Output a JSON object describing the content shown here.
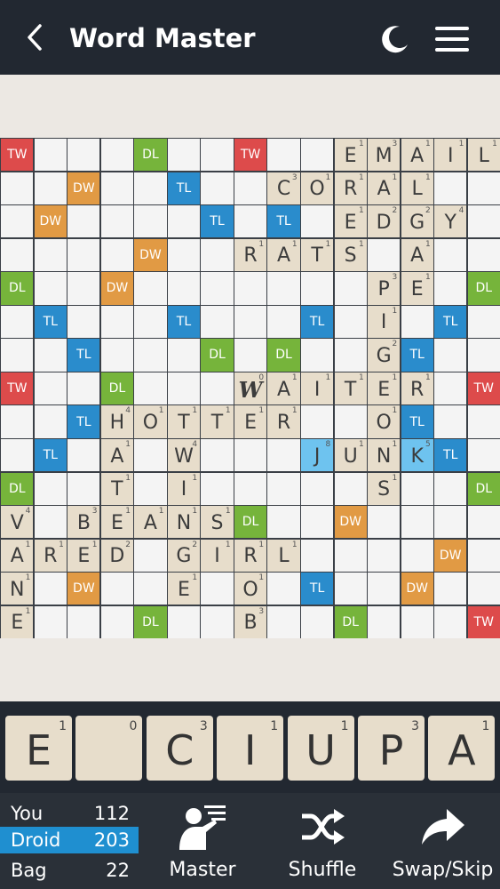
{
  "header": {
    "title": "Word Master"
  },
  "board": {
    "size": 15,
    "premiums": [
      [
        0,
        0,
        "TW"
      ],
      [
        4,
        0,
        "DL"
      ],
      [
        7,
        0,
        "TW"
      ],
      [
        2,
        1,
        "DW"
      ],
      [
        5,
        1,
        "TL"
      ],
      [
        1,
        2,
        "DW"
      ],
      [
        6,
        2,
        "TL"
      ],
      [
        8,
        2,
        "TL"
      ],
      [
        4,
        3,
        "DW"
      ],
      [
        0,
        4,
        "DL"
      ],
      [
        3,
        4,
        "DW"
      ],
      [
        14,
        4,
        "DL"
      ],
      [
        1,
        5,
        "TL"
      ],
      [
        5,
        5,
        "TL"
      ],
      [
        9,
        5,
        "TL"
      ],
      [
        13,
        5,
        "TL"
      ],
      [
        2,
        6,
        "TL"
      ],
      [
        6,
        6,
        "DL"
      ],
      [
        8,
        6,
        "DL"
      ],
      [
        12,
        6,
        "TL"
      ],
      [
        0,
        7,
        "TW"
      ],
      [
        3,
        7,
        "DL"
      ],
      [
        14,
        7,
        "TW"
      ],
      [
        2,
        8,
        "TL"
      ],
      [
        12,
        8,
        "TL"
      ],
      [
        1,
        9,
        "TL"
      ],
      [
        13,
        9,
        "TL"
      ],
      [
        0,
        10,
        "DL"
      ],
      [
        14,
        10,
        "DL"
      ],
      [
        7,
        11,
        "DL"
      ],
      [
        10,
        11,
        "DW"
      ],
      [
        13,
        12,
        "DW"
      ],
      [
        2,
        13,
        "DW"
      ],
      [
        9,
        13,
        "TL"
      ],
      [
        12,
        13,
        "DW"
      ],
      [
        4,
        14,
        "DL"
      ],
      [
        10,
        14,
        "DL"
      ],
      [
        14,
        14,
        "TW"
      ]
    ],
    "tiles": [
      [
        10,
        0,
        "E",
        "1"
      ],
      [
        11,
        0,
        "M",
        "3"
      ],
      [
        12,
        0,
        "A",
        "1"
      ],
      [
        13,
        0,
        "I",
        "1"
      ],
      [
        14,
        0,
        "L",
        "1"
      ],
      [
        8,
        1,
        "C",
        "3"
      ],
      [
        9,
        1,
        "O",
        "1"
      ],
      [
        10,
        1,
        "R",
        "1"
      ],
      [
        11,
        1,
        "A",
        "1"
      ],
      [
        12,
        1,
        "L",
        "1"
      ],
      [
        10,
        2,
        "E",
        "1"
      ],
      [
        11,
        2,
        "D",
        "2"
      ],
      [
        12,
        2,
        "G",
        "2"
      ],
      [
        13,
        2,
        "Y",
        "4"
      ],
      [
        7,
        3,
        "R",
        "1"
      ],
      [
        8,
        3,
        "A",
        "1"
      ],
      [
        9,
        3,
        "T",
        "1"
      ],
      [
        10,
        3,
        "S",
        "1"
      ],
      [
        12,
        3,
        "A",
        "1"
      ],
      [
        11,
        4,
        "P",
        "3"
      ],
      [
        12,
        4,
        "E",
        "1"
      ],
      [
        11,
        5,
        "I",
        "1"
      ],
      [
        11,
        6,
        "G",
        "2"
      ],
      [
        7,
        7,
        "W",
        "0",
        "script"
      ],
      [
        8,
        7,
        "A",
        "1"
      ],
      [
        9,
        7,
        "I",
        "1"
      ],
      [
        10,
        7,
        "T",
        "1"
      ],
      [
        11,
        7,
        "E",
        "1"
      ],
      [
        12,
        7,
        "R",
        "1"
      ],
      [
        3,
        8,
        "H",
        "4"
      ],
      [
        4,
        8,
        "O",
        "1"
      ],
      [
        5,
        8,
        "T",
        "1"
      ],
      [
        6,
        8,
        "T",
        "1"
      ],
      [
        7,
        8,
        "E",
        "1"
      ],
      [
        8,
        8,
        "R",
        "1"
      ],
      [
        11,
        8,
        "O",
        "1"
      ],
      [
        3,
        9,
        "A",
        "1"
      ],
      [
        5,
        9,
        "W",
        "4"
      ],
      [
        9,
        9,
        "J",
        "8",
        "hl"
      ],
      [
        10,
        9,
        "U",
        "1"
      ],
      [
        11,
        9,
        "N",
        "1"
      ],
      [
        12,
        9,
        "K",
        "5",
        "hl"
      ],
      [
        3,
        10,
        "T",
        "1"
      ],
      [
        5,
        10,
        "I",
        "1"
      ],
      [
        11,
        10,
        "S",
        "1"
      ],
      [
        0,
        11,
        "V",
        "4"
      ],
      [
        2,
        11,
        "B",
        "3"
      ],
      [
        3,
        11,
        "E",
        "1"
      ],
      [
        4,
        11,
        "A",
        "1"
      ],
      [
        5,
        11,
        "N",
        "1"
      ],
      [
        6,
        11,
        "S",
        "1"
      ],
      [
        0,
        12,
        "A",
        "1"
      ],
      [
        1,
        12,
        "R",
        "1"
      ],
      [
        2,
        12,
        "E",
        "1"
      ],
      [
        3,
        12,
        "D",
        "2"
      ],
      [
        5,
        12,
        "G",
        "2"
      ],
      [
        6,
        12,
        "I",
        "1"
      ],
      [
        7,
        12,
        "R",
        "1"
      ],
      [
        8,
        12,
        "L",
        "1"
      ],
      [
        0,
        13,
        "N",
        "1"
      ],
      [
        5,
        13,
        "E",
        "1"
      ],
      [
        7,
        13,
        "O",
        "1"
      ],
      [
        0,
        14,
        "E",
        "1"
      ],
      [
        7,
        14,
        "B",
        "3"
      ]
    ],
    "highlight_color": "#6ec3ef"
  },
  "rack": {
    "tiles": [
      {
        "letter": "E",
        "points": "1"
      },
      {
        "letter": "",
        "points": "0"
      },
      {
        "letter": "C",
        "points": "3"
      },
      {
        "letter": "I",
        "points": "1"
      },
      {
        "letter": "U",
        "points": "1"
      },
      {
        "letter": "P",
        "points": "3"
      },
      {
        "letter": "A",
        "points": "1"
      }
    ]
  },
  "scores": {
    "you_label": "You",
    "you_score": "112",
    "droid_label": "Droid",
    "droid_score": "203",
    "bag_label": "Bag",
    "bag_count": "22"
  },
  "actions": {
    "master_label": "Master",
    "shuffle_label": "Shuffle",
    "swap_label": "Swap/Skip"
  },
  "colors": {
    "TW": "#dd4b4b",
    "DW": "#e19a44",
    "TL": "#2a8ccc",
    "DL": "#76b43b",
    "tile": "#e7ddcb",
    "header": "#222831",
    "active_score": "#1f8fd0"
  }
}
